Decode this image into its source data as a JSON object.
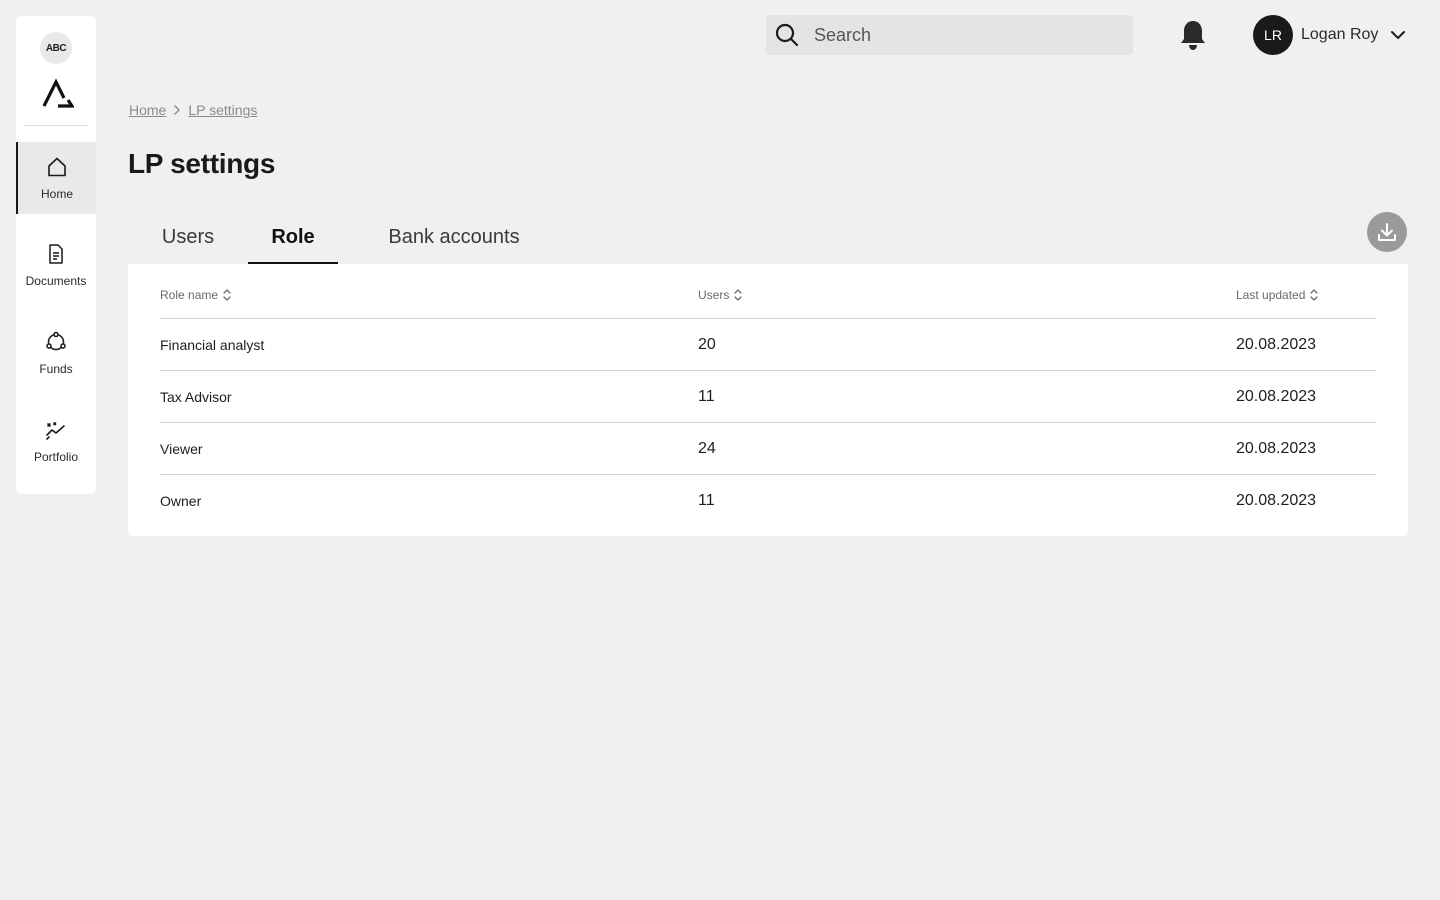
{
  "sidebar": {
    "org_badge": "ABC",
    "items": [
      {
        "label": "Home",
        "icon": "home-icon",
        "active": true
      },
      {
        "label": "Documents",
        "icon": "document-icon",
        "active": false
      },
      {
        "label": "Funds",
        "icon": "funds-icon",
        "active": false
      },
      {
        "label": "Portfolio",
        "icon": "portfolio-icon",
        "active": false
      }
    ]
  },
  "header": {
    "search_placeholder": "Search",
    "user": {
      "initials": "LR",
      "name": "Logan Roy"
    }
  },
  "breadcrumb": [
    {
      "label": "Home"
    },
    {
      "label": "LP settings"
    }
  ],
  "page_title": "LP settings",
  "tabs": [
    {
      "label": "Users",
      "active": false
    },
    {
      "label": "Role",
      "active": true
    },
    {
      "label": "Bank accounts",
      "active": false
    }
  ],
  "table": {
    "columns": [
      "Role name",
      "Users",
      "Last updated"
    ],
    "rows": [
      {
        "role": "Financial analyst",
        "users": "20",
        "updated": "20.08.2023"
      },
      {
        "role": "Tax Advisor",
        "users": "11",
        "updated": "20.08.2023"
      },
      {
        "role": "Viewer",
        "users": "24",
        "updated": "20.08.2023"
      },
      {
        "role": "Owner",
        "users": "11",
        "updated": "20.08.2023"
      }
    ]
  },
  "colors": {
    "background": "#f0f0f2",
    "surface": "#ffffff",
    "text": "#1a1a1a",
    "muted": "#8a8a8a",
    "active_nav": "#e9e9eb",
    "download_button": "#9a9a9c"
  }
}
